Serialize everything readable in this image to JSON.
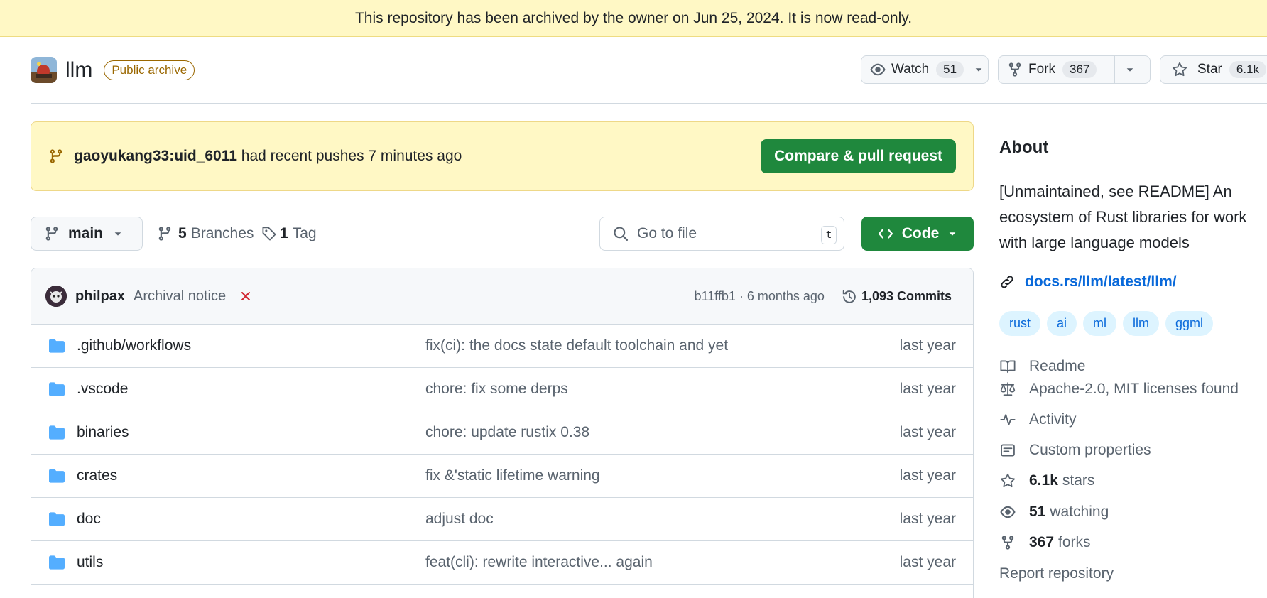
{
  "banner": {
    "text": "This repository has been archived by the owner on Jun 25, 2024. It is now read-only."
  },
  "repo": {
    "name": "llm",
    "badge": "Public archive"
  },
  "header_actions": {
    "watch_label": "Watch",
    "watch_count": "51",
    "fork_label": "Fork",
    "fork_count": "367",
    "star_label": "Star",
    "star_count": "6.1k"
  },
  "push_notice": {
    "branch": "gaoyukang33:uid_6011",
    "text": "had recent pushes 7 minutes ago",
    "button": "Compare & pull request"
  },
  "toolbar": {
    "branch": "main",
    "branches_count": "5",
    "branches_label": "Branches",
    "tags_count": "1",
    "tags_label": "Tag",
    "search_placeholder": "Go to file",
    "search_shortcut": "t",
    "code_button": "Code"
  },
  "latest_commit": {
    "author": "philpax",
    "message": "Archival notice",
    "status": "failed",
    "hash_time": "b11ffb1 · 6 months ago",
    "commits_count": "1,093",
    "commits_label": "Commits"
  },
  "files": [
    {
      "name": ".github/workflows",
      "message": "fix(ci): the docs state default toolchain and yet",
      "time": "last year"
    },
    {
      "name": ".vscode",
      "message": "chore: fix some derps",
      "time": "last year"
    },
    {
      "name": "binaries",
      "message": "chore: update rustix 0.38",
      "time": "last year"
    },
    {
      "name": "crates",
      "message": "fix &'static lifetime warning",
      "time": "last year"
    },
    {
      "name": "doc",
      "message": "adjust doc",
      "time": "last year"
    },
    {
      "name": "utils",
      "message": "feat(cli): rewrite interactive... again",
      "time": "last year"
    }
  ],
  "about": {
    "title": "About",
    "description_lines": [
      "[Unmaintained, see README] An",
      "ecosystem of Rust libraries for work",
      "with large language models"
    ],
    "link": "docs.rs/llm/latest/llm/",
    "topics": [
      "rust",
      "ai",
      "ml",
      "llm",
      "ggml"
    ],
    "readme": "Readme",
    "license": "Apache-2.0, MIT licenses found",
    "activity": "Activity",
    "custom_properties": "Custom properties",
    "stars_count": "6.1k",
    "stars_label": "stars",
    "watching_count": "51",
    "watching_label": "watching",
    "forks_count": "367",
    "forks_label": "forks",
    "report": "Report repository"
  },
  "colors": {
    "accent_green": "#1f883d",
    "link_blue": "#0969da",
    "banner_yellow": "#fff8c5",
    "folder_blue": "#54aeff",
    "fail_red": "#d1242f"
  }
}
